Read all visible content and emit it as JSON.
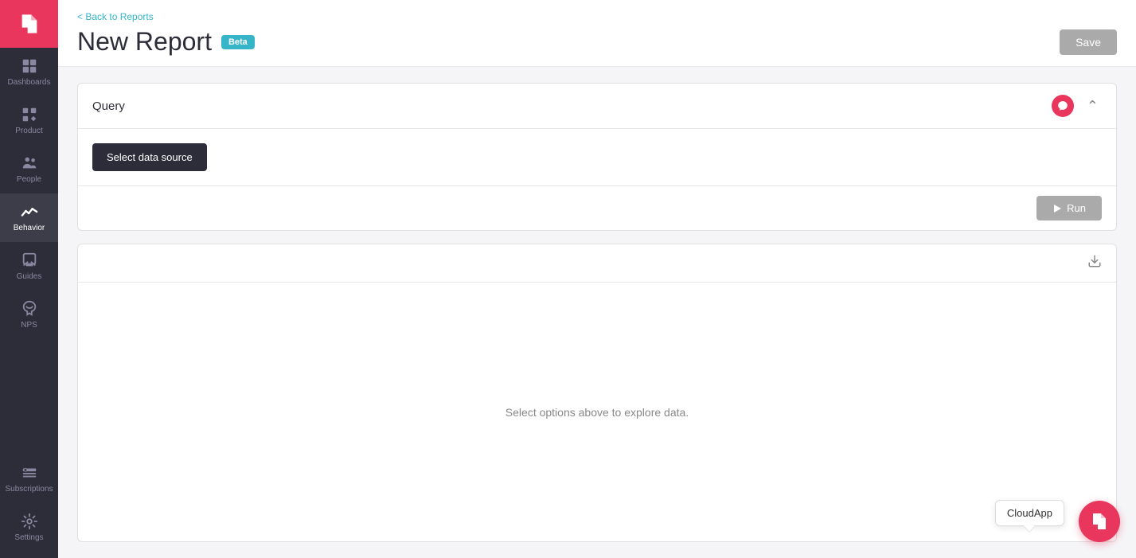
{
  "sidebar": {
    "logo_alt": "Pendo logo",
    "items": [
      {
        "id": "dashboards",
        "label": "Dashboards",
        "active": false
      },
      {
        "id": "product",
        "label": "Product",
        "active": false
      },
      {
        "id": "people",
        "label": "People",
        "active": false
      },
      {
        "id": "behavior",
        "label": "Behavior",
        "active": true
      },
      {
        "id": "guides",
        "label": "Guides",
        "active": false
      },
      {
        "id": "nps",
        "label": "NPS",
        "active": false
      }
    ],
    "bottom_items": [
      {
        "id": "subscriptions",
        "label": "Subscriptions"
      },
      {
        "id": "settings",
        "label": "Settings"
      }
    ]
  },
  "header": {
    "back_link": "< Back to Reports",
    "title": "New Report",
    "beta_badge": "Beta",
    "save_button": "Save"
  },
  "query_card": {
    "title": "Query",
    "select_data_source_button": "Select data source",
    "run_button": "Run"
  },
  "results_card": {
    "empty_message": "Select options above to explore data."
  },
  "cloudapp_tooltip": "CloudApp",
  "colors": {
    "accent": "#e8365d",
    "teal": "#36b5c8",
    "sidebar_bg": "#2d2d3a",
    "gray_button": "#aaaaaa"
  }
}
